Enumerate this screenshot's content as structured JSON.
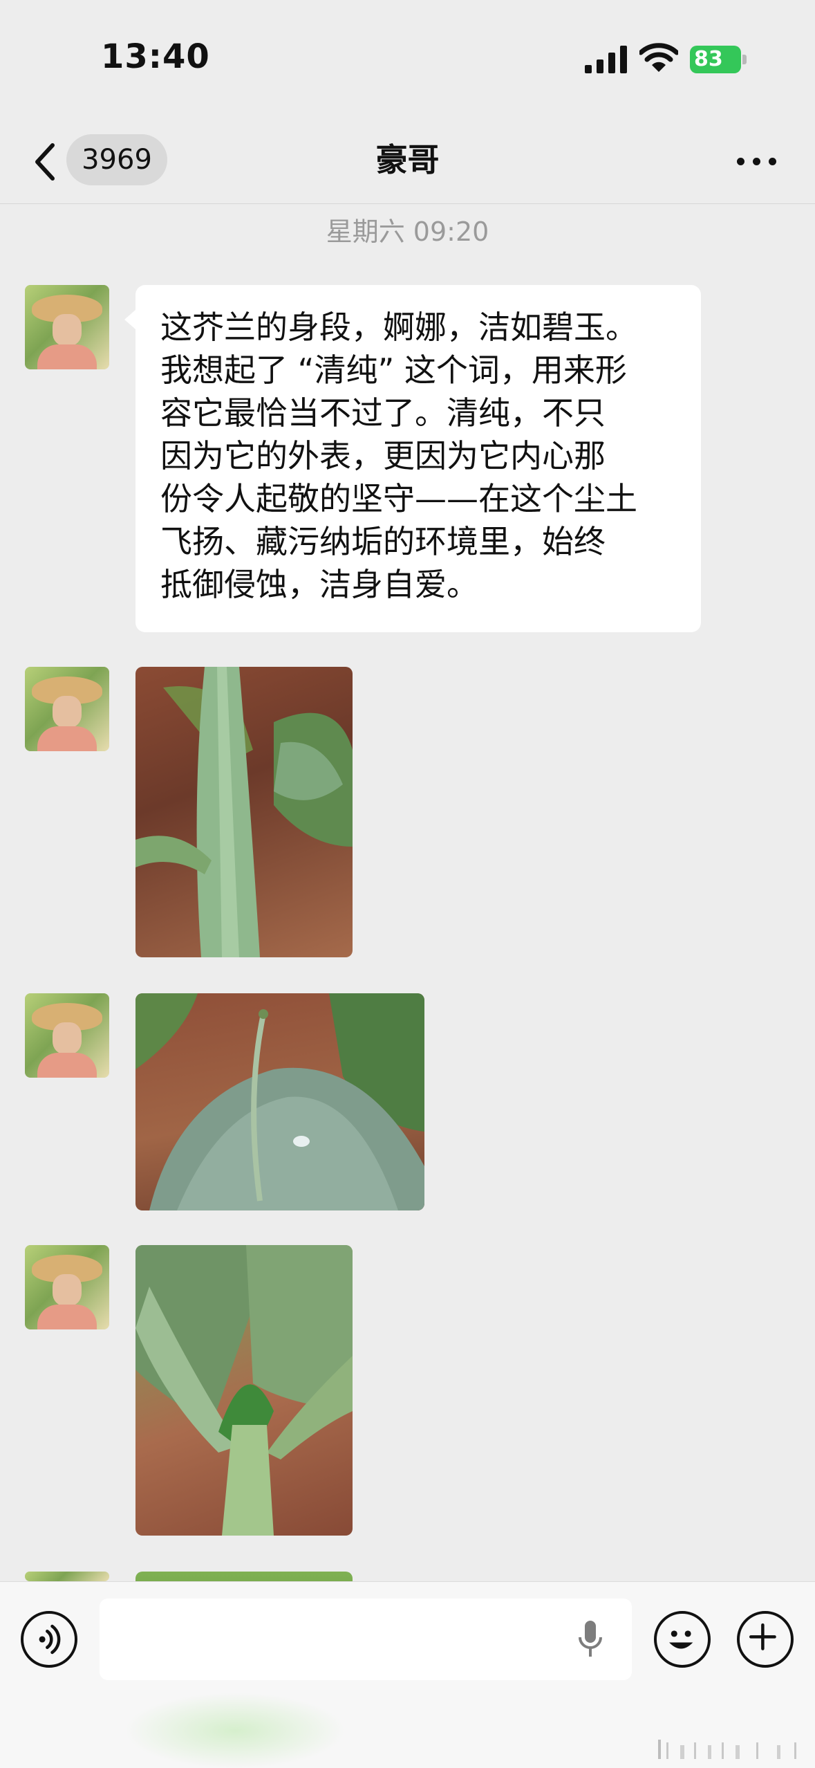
{
  "status_bar": {
    "time": "13:40",
    "battery": "83",
    "icons": [
      "signal-icon",
      "wifi-icon",
      "battery-icon"
    ]
  },
  "nav": {
    "unread_count": "3969",
    "title": "豪哥",
    "icons": [
      "chevron-left-icon",
      "more-icon"
    ]
  },
  "chat": {
    "timestamp": "星期六 09:20",
    "messages": [
      {
        "type": "text",
        "text": "这芥兰的身段，婀娜，洁如碧玉。\n我想起了 “清纯” 这个词，用来形\n容它最恰当不过了。清纯，不只\n因为它的外表，更因为它内心那\n份令人起敬的坚守——在这个尘土\n飞扬、藏污纳垢的环境里，始终\n抵御侵蚀，洁身自爱。"
      },
      {
        "type": "image",
        "subject": "kale stem with leaf"
      },
      {
        "type": "image",
        "subject": "kale leaf with water droplet"
      },
      {
        "type": "image",
        "subject": "kale stalk top with buds"
      },
      {
        "type": "image",
        "subject": "partially visible green photo"
      }
    ]
  },
  "input_bar": {
    "icons": [
      "voice-icon",
      "microphone-icon",
      "emoji-icon",
      "plus-icon"
    ]
  },
  "colors": {
    "background": "#ededed",
    "bubble": "#ffffff",
    "battery": "#34c759",
    "timestamp": "#9a9a9a"
  }
}
